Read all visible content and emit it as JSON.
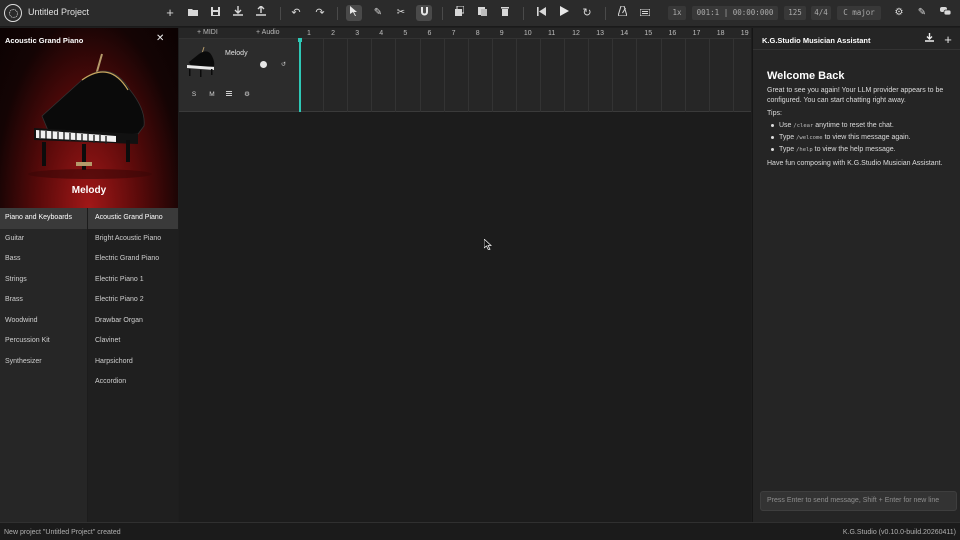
{
  "toolbar": {
    "project_title": "Untitled Project",
    "icons": [
      "logo-icon",
      "new-icon",
      "open-icon",
      "save-icon",
      "export-icon",
      "import-icon",
      "undo-icon",
      "redo-icon",
      "pointer-icon",
      "pencil-icon",
      "scissors-icon",
      "magnet-icon",
      "copy-icon",
      "paste-icon",
      "delete-icon",
      "skip-back-icon",
      "play-icon",
      "loop-icon",
      "metronome-icon",
      "keyboard-icon",
      "settings-icon",
      "magic-icon",
      "chat-icon"
    ],
    "speed": "1x",
    "position": "001:1 | 00:00:000",
    "tempo": "125",
    "time_signature": "4/4",
    "key": "C major"
  },
  "instrument_panel": {
    "title": "Acoustic Grand Piano",
    "track_name": "Melody",
    "categories": [
      "Piano and Keyboards",
      "Guitar",
      "Bass",
      "Strings",
      "Brass",
      "Woodwind",
      "Percussion Kit",
      "Synthesizer"
    ],
    "selected_category": "Piano and Keyboards",
    "presets": [
      "Acoustic Grand Piano",
      "Bright Acoustic Piano",
      "Electric Grand Piano",
      "Electric Piano 1",
      "Electric Piano 2",
      "Drawbar Organ",
      "Clavinet",
      "Harpsichord",
      "Accordion"
    ],
    "selected_preset": "Acoustic Grand Piano"
  },
  "arrangement": {
    "add_midi": "+ MIDI",
    "add_audio": "+ Audio",
    "bars": [
      "1",
      "2",
      "3",
      "4",
      "5",
      "6",
      "7",
      "8",
      "9",
      "10",
      "11",
      "12",
      "13",
      "14",
      "15",
      "16",
      "17",
      "18",
      "19"
    ],
    "track": {
      "name": "Melody",
      "buttons": [
        "S",
        "M"
      ]
    }
  },
  "assistant": {
    "title": "K.G.Studio Musician Assistant",
    "welcome_heading": "Welcome Back",
    "intro": "Great to see you again! Your LLM provider appears to be configured. You can start chatting right away.",
    "tips_label": "Tips:",
    "tips": [
      {
        "pre": "Use ",
        "code": "/clear",
        "post": " anytime to reset the chat."
      },
      {
        "pre": "Type ",
        "code": "/welcome",
        "post": " to view this message again."
      },
      {
        "pre": "Type ",
        "code": "/help",
        "post": " to view the help message."
      }
    ],
    "outro": "Have fun composing with K.G.Studio Musician Assistant.",
    "input_placeholder": "Press Enter to send message, Shift + Enter for new line"
  },
  "status": {
    "message": "New project \"Untitled Project\" created",
    "version": "K.G.Studio (v0.10.0-build.20260411)"
  }
}
